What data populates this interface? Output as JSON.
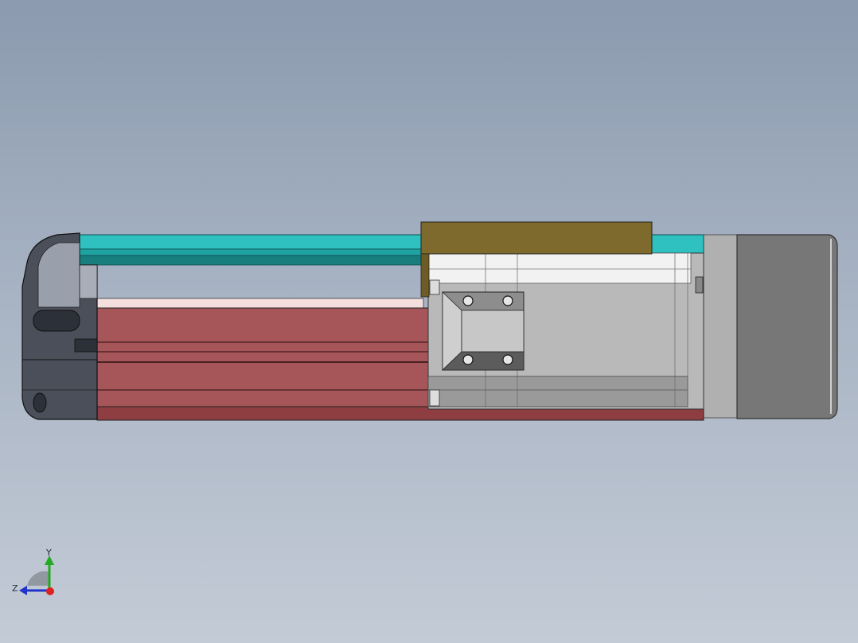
{
  "view": {
    "background_top": "#8b9aaf",
    "background_bottom": "#c3cbd6"
  },
  "model": {
    "parts": [
      {
        "name": "end-cap",
        "color": "#3b3f48"
      },
      {
        "name": "linear-guide-rail",
        "color": "#27b3b3"
      },
      {
        "name": "actuator-body",
        "color": "#a65558"
      },
      {
        "name": "carriage-plate",
        "color": "#7d6a2c"
      },
      {
        "name": "slider-block",
        "color": "#b5b5b5"
      },
      {
        "name": "motor",
        "color": "#7a7a7a"
      }
    ]
  },
  "triad": {
    "y_label": "Y",
    "z_label": "Z",
    "y_color": "#22aa22",
    "z_color": "#2233cc",
    "x_color": "#dd2222"
  }
}
